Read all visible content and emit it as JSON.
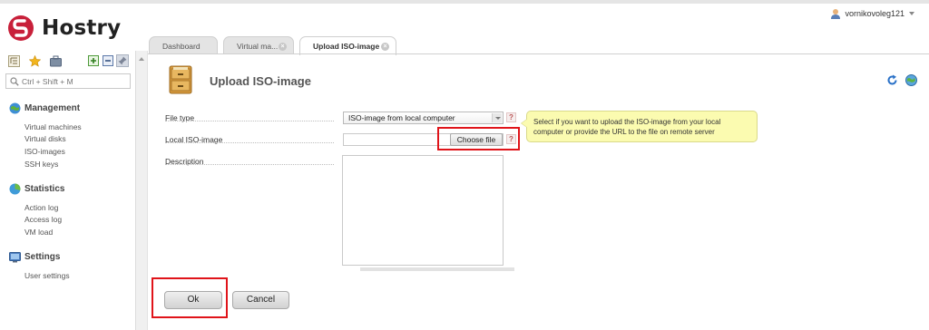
{
  "brand": {
    "name": "Hostry"
  },
  "user": {
    "name": "vornikovoleg121"
  },
  "sidebar": {
    "search_placeholder": "Ctrl + Shift + M",
    "sections": [
      {
        "title": "Management",
        "items": [
          "Virtual machines",
          "Virtual disks",
          "ISO-images",
          "SSH keys"
        ]
      },
      {
        "title": "Statistics",
        "items": [
          "Action log",
          "Access log",
          "VM load"
        ]
      },
      {
        "title": "Settings",
        "items": [
          "User settings"
        ]
      }
    ]
  },
  "tabs": [
    {
      "label": "Dashboard"
    },
    {
      "label": "Virtual ma..."
    },
    {
      "label": "Upload ISO-image"
    }
  ],
  "form": {
    "title": "Upload ISO-image",
    "file_type_label": "File type",
    "file_type_value": "ISO-image from local computer",
    "local_iso_label": "Local ISO-image",
    "choose_file_label": "Choose file",
    "description_label": "Description",
    "help_glyph": "?",
    "tooltip": "Select if you want to upload the ISO-image from your local computer or provide the URL to the file on remote server",
    "ok_label": "Ok",
    "cancel_label": "Cancel"
  },
  "colors": {
    "brand_red": "#c8203a",
    "highlight": "#e0141a",
    "tooltip_bg": "#fbfbb0"
  },
  "icons": [
    "hostry-logo",
    "user-icon",
    "tree-icon",
    "star-icon",
    "briefcase-icon",
    "expand-icon",
    "collapse-icon",
    "pin-icon",
    "search-icon",
    "management-icon",
    "statistics-icon",
    "settings-icon",
    "cabinet-icon",
    "refresh-icon",
    "globe-icon"
  ]
}
